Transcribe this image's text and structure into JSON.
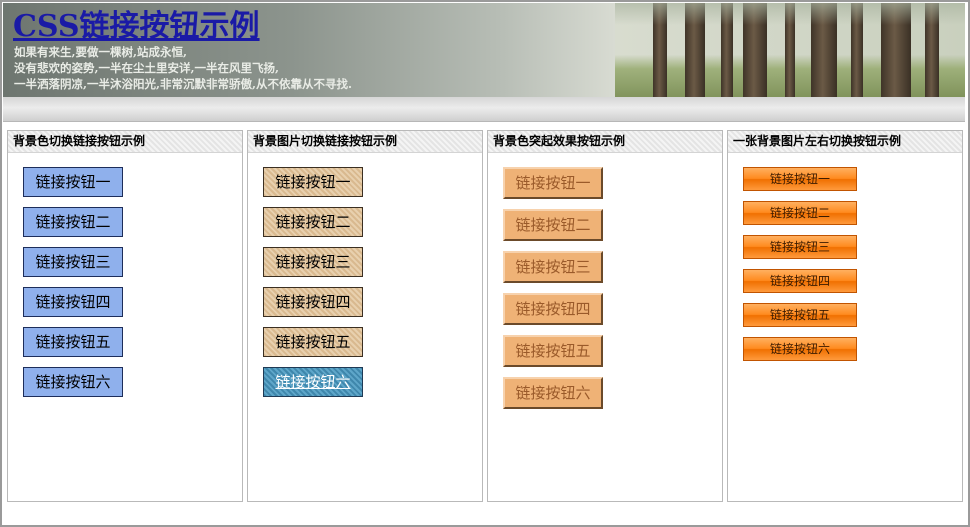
{
  "header": {
    "title": "CSS链接按钮示例",
    "lines": [
      "如果有来生,要做一棵树,站成永恒,",
      "没有悲欢的姿势,一半在尘土里安详,一半在风里飞扬,",
      "一半洒落阴凉,一半沐浴阳光,非常沉默非常骄傲,从不依靠从不寻找."
    ]
  },
  "panels": [
    {
      "heading": "背景色切换链接按钮示例",
      "buttons": [
        "链接按钮一",
        "链接按钮二",
        "链接按钮三",
        "链接按钮四",
        "链接按钮五",
        "链接按钮六"
      ]
    },
    {
      "heading": "背景图片切换链接按钮示例",
      "buttons": [
        "链接按钮一",
        "链接按钮二",
        "链接按钮三",
        "链接按钮四",
        "链接按钮五",
        "链接按钮六"
      ]
    },
    {
      "heading": "背景色突起效果按钮示例",
      "buttons": [
        "链接按钮一",
        "链接按钮二",
        "链接按钮三",
        "链接按钮四",
        "链接按钮五",
        "链接按钮六"
      ]
    },
    {
      "heading": "一张背景图片左右切换按钮示例",
      "buttons": [
        "链接按钮一",
        "链接按钮二",
        "链接按钮三",
        "链接按钮四",
        "链接按钮五",
        "链接按钮六"
      ]
    }
  ],
  "colors": {
    "title": "#1a1aa6",
    "panel1_button": "#8fb0ec",
    "panel2_button_active": "#3f87ac",
    "panel3_button": "#efb276",
    "panel4_button": "#ff8a1e"
  }
}
